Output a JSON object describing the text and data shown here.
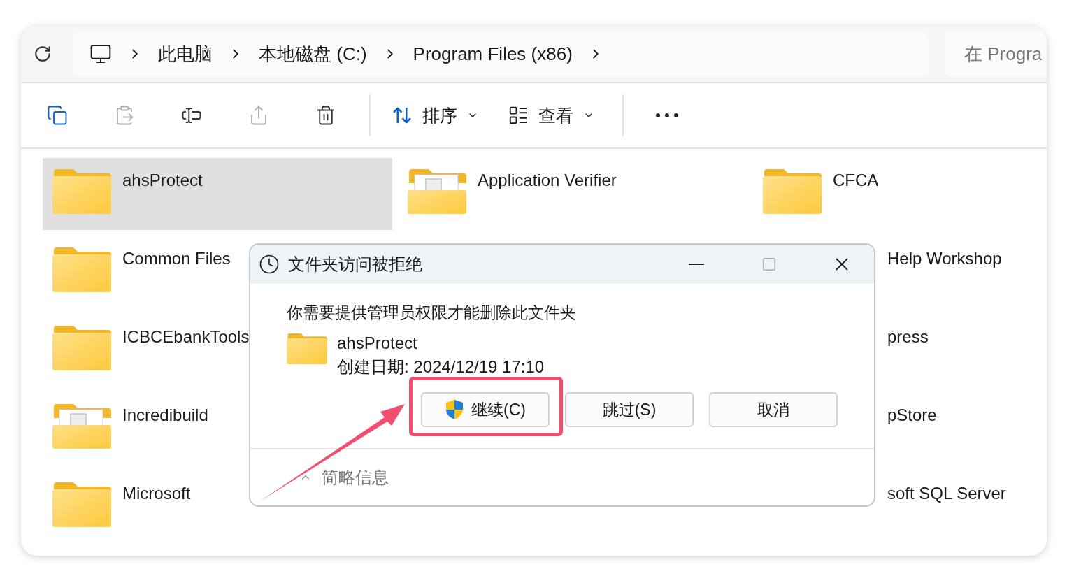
{
  "address_bar": {
    "crumbs": [
      "此电脑",
      "本地磁盘 (C:)",
      "Program Files (x86)"
    ],
    "search_placeholder": "在 Progra"
  },
  "toolbar": {
    "buttons": [
      {
        "kind": "copy",
        "disabled": false
      },
      {
        "kind": "paste",
        "disabled": true
      },
      {
        "kind": "rename",
        "disabled": false
      },
      {
        "kind": "share",
        "disabled": true
      },
      {
        "kind": "delete",
        "disabled": false
      }
    ],
    "sort_label": "排序",
    "view_label": "查看"
  },
  "items": [
    {
      "label": "ahsProtect",
      "kind": "folder",
      "selected": true
    },
    {
      "label": "Application Verifier",
      "kind": "app-folder",
      "selected": false
    },
    {
      "label": "CFCA",
      "kind": "folder",
      "selected": false
    },
    {
      "label": "Common Files",
      "kind": "folder",
      "selected": false
    },
    {
      "kind": "hidden"
    },
    {
      "label": "Help Workshop",
      "kind": "partial",
      "selected": false
    },
    {
      "label": "ICBCEbankTools",
      "kind": "folder",
      "selected": false
    },
    {
      "kind": "hidden"
    },
    {
      "label": "press",
      "kind": "partial",
      "selected": false
    },
    {
      "label": "Incredibuild",
      "kind": "app-folder",
      "selected": false
    },
    {
      "kind": "hidden"
    },
    {
      "label": "pStore",
      "kind": "partial",
      "selected": false
    },
    {
      "label": "Microsoft",
      "kind": "folder",
      "selected": false
    },
    {
      "kind": "hidden"
    },
    {
      "label": "soft SQL Server",
      "kind": "partial",
      "selected": false
    }
  ],
  "dialog": {
    "title": "文件夹访问被拒绝",
    "maximize_disabled": true,
    "message": "你需要提供管理员权限才能删除此文件夹",
    "folder_name": "ahsProtect",
    "created": "创建日期: 2024/12/19 17:10",
    "buttons": [
      {
        "label": "继续(C)",
        "kind": "elevate"
      },
      {
        "label": "跳过(S)",
        "kind": "plain"
      },
      {
        "label": "取消",
        "kind": "plain"
      }
    ],
    "details_toggle": "简略信息"
  }
}
